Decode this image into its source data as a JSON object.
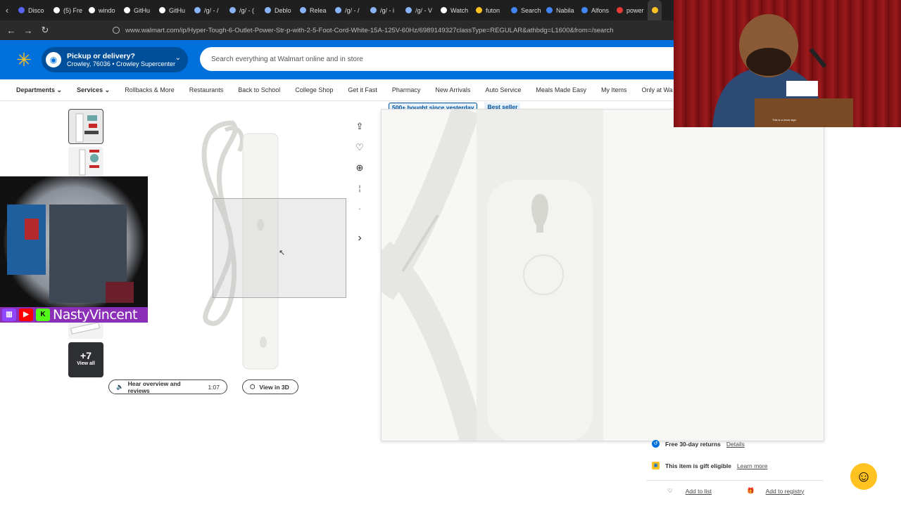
{
  "browser": {
    "tabs": [
      {
        "label": "Disco",
        "color": "#5865f2"
      },
      {
        "label": "(5) Fre",
        "color": "#ffffff"
      },
      {
        "label": "windo",
        "color": "#ffffff"
      },
      {
        "label": "GitHu",
        "color": "#ffffff"
      },
      {
        "label": "GitHu",
        "color": "#ffffff"
      },
      {
        "label": "/g/ - /",
        "color": "#8ab4f8"
      },
      {
        "label": "/g/ - (",
        "color": "#8ab4f8"
      },
      {
        "label": "Deblo",
        "color": "#8ab4f8"
      },
      {
        "label": "Relea",
        "color": "#8ab4f8"
      },
      {
        "label": "/g/ - /",
        "color": "#8ab4f8"
      },
      {
        "label": "/g/ - i",
        "color": "#8ab4f8"
      },
      {
        "label": "/g/ - V",
        "color": "#8ab4f8"
      },
      {
        "label": "Watch",
        "color": "#ffffff"
      },
      {
        "label": "futon",
        "color": "#ffc220"
      },
      {
        "label": "Search",
        "color": "#4285f4"
      },
      {
        "label": "Nabila",
        "color": "#4285f4"
      },
      {
        "label": "Alfons",
        "color": "#4285f4"
      },
      {
        "label": "power",
        "color": "#e53935"
      }
    ],
    "url": "www.walmart.com/ip/Hyper-Tough-6-Outlet-Power-Str-p-with-2-5-Foot-Cord-White-15A-125V-60Hz/6989149327classType=REGULAR&athbdg=L1600&from=/search"
  },
  "header": {
    "pickup_title": "Pickup or delivery?",
    "pickup_sub": "Crowley, 76036 • Crowley Supercenter",
    "search_placeholder": "Search everything at Walmart online and in store"
  },
  "nav": {
    "departments": "Departments",
    "services": "Services",
    "items": [
      "Rollbacks & More",
      "Restaurants",
      "Back to School",
      "College Shop",
      "Get it Fast",
      "Pharmacy",
      "New Arrivals",
      "Auto Service",
      "Meals Made Easy",
      "My Items",
      "Only at Wa"
    ]
  },
  "gallery": {
    "more_count": "+7",
    "view_all": "View all",
    "hear_overview": "Hear overview and reviews",
    "hear_time": "1:07",
    "view_3d": "View in 3D"
  },
  "badges": {
    "bought": "500+ bought since yesterday",
    "best_seller": "Best seller"
  },
  "info": {
    "returns": "Free 30-day returns",
    "returns_link": "Details",
    "gift": "This item is gift eligible",
    "gift_link": "Learn more",
    "add_list": "Add to list",
    "add_registry": "Add to registry"
  },
  "stream": {
    "name": "NastyVincent",
    "sign": "This is a news sign"
  }
}
